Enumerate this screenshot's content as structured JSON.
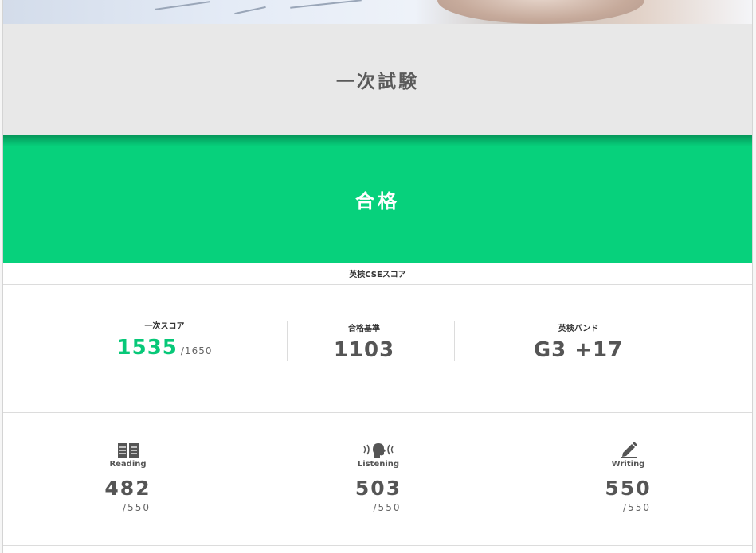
{
  "exam": {
    "title": "一次試験"
  },
  "result": {
    "status": "合格",
    "color": "#07d17c"
  },
  "cse": {
    "label": "英検CSEスコア"
  },
  "summary": {
    "first_score": {
      "label": "一次スコア",
      "value": "1535",
      "max": "/1650",
      "color": "#07c878"
    },
    "pass_line": {
      "label": "合格基準",
      "value": "1103"
    },
    "band": {
      "label": "英検バンド",
      "value": "G3 +17"
    }
  },
  "skills": [
    {
      "name": "Reading",
      "icon": "book-icon",
      "score": "482",
      "max": "/550"
    },
    {
      "name": "Listening",
      "icon": "speaking-head-icon",
      "score": "503",
      "max": "/550"
    },
    {
      "name": "Writing",
      "icon": "pencil-icon",
      "score": "550",
      "max": "/550"
    }
  ]
}
